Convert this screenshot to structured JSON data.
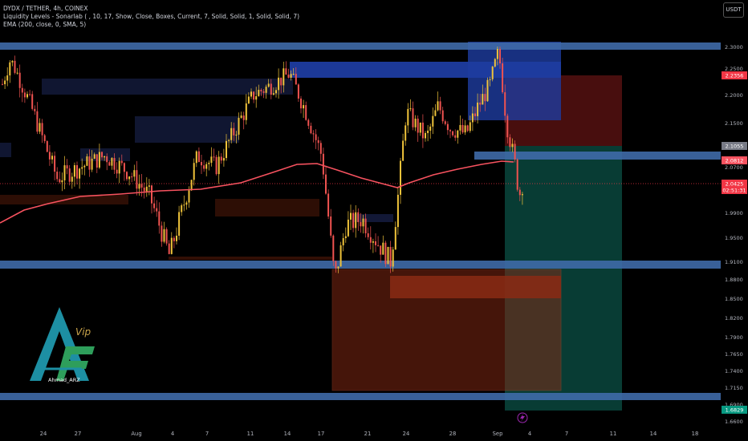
{
  "legend": {
    "symbol": "DYDX / TETHER, 4h, COINEX",
    "indicator1": "Liquidity Levels - Sonarlab ( , 10, 17, Show, Close, Boxes, Current, 7, Solid, Solid, 1, Solid, Solid, 7)",
    "indicator2": "EMA (200, close, 0, SMA, 5)"
  },
  "currency_label": "USDT",
  "logo": {
    "text": "Ahmad_ARZ",
    "script_text": "Vip"
  },
  "chart_data": {
    "type": "candlestick",
    "symbol": "DYDX / TETHER",
    "timeframe": "4h",
    "exchange": "COINEX",
    "currency": "USDT",
    "ylim": [
      1.66,
      2.33
    ],
    "y_ticks": [
      "2.3000",
      "2.2500",
      "2.2000",
      "2.1500",
      "2.0700",
      "1.9900",
      "1.9500",
      "1.9100",
      "1.8800",
      "1.8500",
      "1.8200",
      "1.7900",
      "1.7650",
      "1.7400",
      "1.7150",
      "1.6900",
      "1.6600"
    ],
    "x_ticks": [
      "24",
      "27",
      "Aug",
      "4",
      "7",
      "11",
      "14",
      "17",
      "21",
      "24",
      "28",
      "Sep",
      "4",
      "7",
      "11",
      "14",
      "18"
    ],
    "price_labels": [
      {
        "value": "2.2356",
        "color": "#f23645"
      },
      {
        "value": "2.1055",
        "color": "#787b86"
      },
      {
        "value": "2.0812",
        "color": "#f7525f"
      },
      {
        "value": "2.0425",
        "color": "#f23645"
      },
      {
        "value": "02:51:31",
        "color": "#f23645"
      },
      {
        "value": "1.6829",
        "color": "#089981"
      }
    ],
    "ema": {
      "period": 200,
      "color": "#f7525f"
    },
    "colors": {
      "up": "#f0c33a",
      "down": "#ef5350",
      "level": "#3f6aa8",
      "supply": "#1e3ca0",
      "demand": "#8a2a14",
      "target": "#0b5045",
      "stop": "#5a1212"
    }
  }
}
